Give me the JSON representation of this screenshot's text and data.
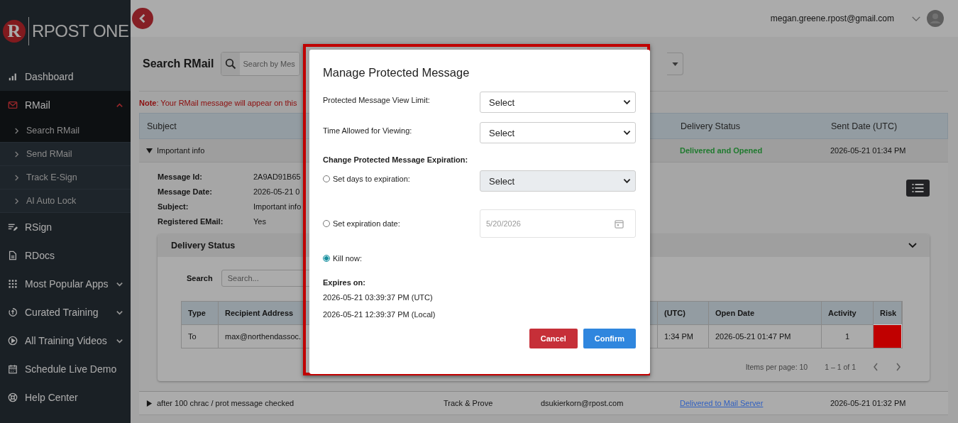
{
  "logo": {
    "badge": "R",
    "text": "RPOST ONE"
  },
  "sidebar": {
    "items": [
      {
        "label": "Dashboard",
        "kind": "link",
        "selected": false
      },
      {
        "label": "RMail",
        "kind": "group",
        "selected": true,
        "expanded": true,
        "children": [
          {
            "label": "Search RMail",
            "selected": true
          },
          {
            "label": "Send RMail",
            "selected": false
          },
          {
            "label": "Track E-Sign",
            "selected": false
          },
          {
            "label": "AI Auto Lock",
            "selected": false
          }
        ]
      },
      {
        "label": "RSign",
        "kind": "link",
        "selected": false
      },
      {
        "label": "RDocs",
        "kind": "link",
        "selected": false
      },
      {
        "label": "Most Popular Apps",
        "kind": "group",
        "selected": false,
        "expanded": false
      },
      {
        "label": "Curated Training",
        "kind": "group",
        "selected": false,
        "expanded": false
      },
      {
        "label": "All Training Videos",
        "kind": "group",
        "selected": false,
        "expanded": false
      },
      {
        "label": "Schedule Live Demo",
        "kind": "link",
        "selected": false
      },
      {
        "label": "Help Center",
        "kind": "link",
        "selected": false
      }
    ]
  },
  "topbar": {
    "user_email": "megan.greene.rpost@gmail.com"
  },
  "page": {
    "title": "Search RMail",
    "search": {
      "placeholder": "Search by Mes"
    },
    "note": "**Note**: Your RMail message will appear on this"
  },
  "results": {
    "columns": [
      "Subject",
      "",
      "",
      "Delivery Status",
      "Sent Date (UTC)"
    ],
    "rows": [
      {
        "subject": "Important info",
        "expanded": true,
        "type": "",
        "recipient": "",
        "status": {
          "text": "Delivered and Opened",
          "kind": "text",
          "color": "#1f7a2e"
        },
        "sent": "2026-05-21 01:34 PM"
      },
      {
        "subject": "after 100 chrac / prot message checked",
        "expanded": false,
        "type": "Track & Prove",
        "recipient": "dsukierkorn@rpost.com",
        "status": {
          "text": "Delivered to Mail Server",
          "kind": "link",
          "color": "#2f5fc0"
        },
        "sent": "2026-05-21 01:32 PM"
      }
    ]
  },
  "details": {
    "fields": [
      {
        "label": "Message Id:",
        "value": "2A9AD91B65"
      },
      {
        "label": "Message Date:",
        "value": "2026-05-21 0"
      },
      {
        "label": "Subject:",
        "value": "Important info"
      },
      {
        "label": "Registered EMail:",
        "value": "Yes"
      }
    ]
  },
  "delivery_status": {
    "title": "Delivery Status",
    "expanded": true,
    "search_label": "Search",
    "search": {
      "placeholder": "Search..."
    },
    "columns": [
      "Type",
      "Recipient Address",
      "(UTC)",
      "Open Date",
      "Activity",
      "Risk"
    ],
    "rows": [
      {
        "type": "To",
        "recipient": "max@northendassoc.",
        "sent": "1:34 PM",
        "open_date": "2026-05-21 01:47 PM",
        "activity": "1",
        "risk": {
          "color": "#c00000"
        }
      }
    ],
    "pagination": {
      "items_per_page": "Items per page: 10",
      "range": "1 – 1 of 1"
    }
  },
  "modal": {
    "title": "Manage Protected Message",
    "selects": [
      {
        "label": "Protected Message View Limit:",
        "value": "Select"
      },
      {
        "label": "Time Allowed for Viewing:",
        "value": "Select"
      }
    ],
    "expiration_heading": "Change Protected Message Expiration:",
    "options": [
      {
        "label": "Set days to expiration:",
        "kind": "select",
        "selected": false,
        "value": "Select",
        "disabled": true
      },
      {
        "label": "Set expiration date:",
        "kind": "date",
        "selected": false,
        "value": "5/20/2026",
        "disabled": true
      },
      {
        "label": "Kill now:",
        "kind": "none",
        "selected": true
      }
    ],
    "expires_heading": "Expires on:",
    "expires": [
      "2026-05-21 03:39:37 PM (UTC)",
      "2026-05-21 12:39:37 PM (Local)"
    ],
    "buttons": [
      {
        "label": "Cancel",
        "kind": "cancel"
      },
      {
        "label": "Confirm",
        "kind": "confirm"
      }
    ]
  }
}
